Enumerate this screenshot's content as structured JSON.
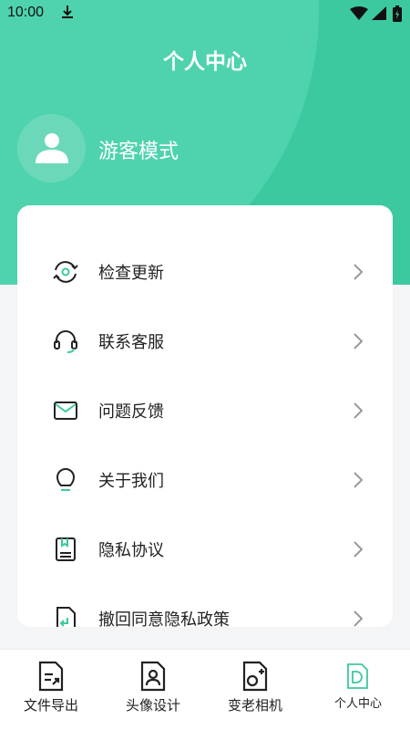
{
  "status_bar": {
    "time": "10:00"
  },
  "header": {
    "title": "个人中心"
  },
  "profile": {
    "name": "游客模式"
  },
  "menu": {
    "items": [
      {
        "label": "检查更新",
        "icon": "refresh-eye-icon"
      },
      {
        "label": "联系客服",
        "icon": "headset-icon"
      },
      {
        "label": "问题反馈",
        "icon": "mail-icon"
      },
      {
        "label": "关于我们",
        "icon": "lightbulb-icon"
      },
      {
        "label": "隐私协议",
        "icon": "document-icon"
      },
      {
        "label": "撤回同意隐私政策",
        "icon": "document-return-icon"
      }
    ]
  },
  "bottom_nav": {
    "items": [
      {
        "label": "文件导出",
        "icon": "file-export-icon"
      },
      {
        "label": "头像设计",
        "icon": "avatar-design-icon"
      },
      {
        "label": "变老相机",
        "icon": "aging-camera-icon"
      },
      {
        "label": "个人中心",
        "icon": "profile-icon",
        "active": true
      }
    ]
  },
  "colors": {
    "accent": "#3cc9a0",
    "accent_light": "#4ed3ae",
    "background": "#f4f5f7"
  }
}
